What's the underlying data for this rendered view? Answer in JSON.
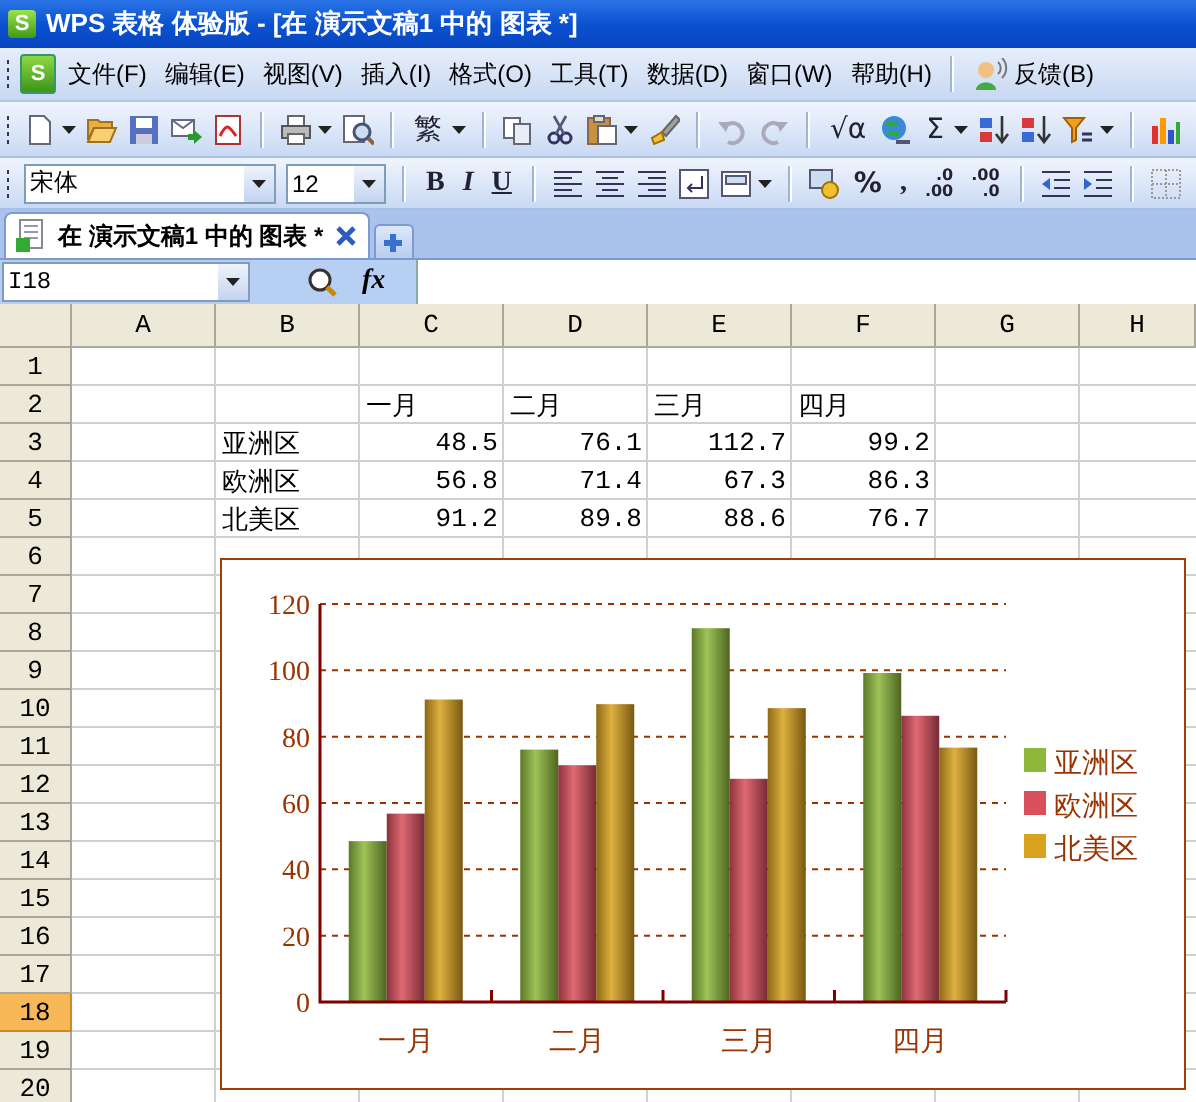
{
  "window": {
    "logo": "S",
    "title": "WPS 表格 体验版 - [在 演示文稿1 中的 图表 *]"
  },
  "menu": {
    "logo": "S",
    "items": [
      "文件(F)",
      "编辑(E)",
      "视图(V)",
      "插入(I)",
      "格式(O)",
      "工具(T)",
      "数据(D)",
      "窗口(W)",
      "帮助(H)"
    ],
    "feedback": "反馈(B)"
  },
  "toolbar1": [
    {
      "kind": "grip"
    },
    {
      "kind": "icon"
    },
    {
      "kind": "caret"
    },
    {
      "kind": "icon"
    },
    {
      "kind": "icon"
    },
    {
      "kind": "icon"
    },
    {
      "kind": "icon"
    },
    {
      "kind": "sep"
    },
    {
      "kind": "icon"
    },
    {
      "kind": "caret"
    },
    {
      "kind": "icon"
    },
    {
      "kind": "sep"
    },
    {
      "kind": "text",
      "text": "繁"
    },
    {
      "kind": "caret"
    },
    {
      "kind": "sep"
    },
    {
      "kind": "icon"
    },
    {
      "kind": "icon"
    },
    {
      "kind": "icon"
    },
    {
      "kind": "caret"
    },
    {
      "kind": "icon"
    },
    {
      "kind": "sep"
    },
    {
      "kind": "icon"
    },
    {
      "kind": "icon"
    },
    {
      "kind": "sep"
    },
    {
      "kind": "text",
      "text": "√α"
    },
    {
      "kind": "icon"
    },
    {
      "kind": "text",
      "text": "Σ"
    },
    {
      "kind": "caret"
    },
    {
      "kind": "icon"
    },
    {
      "kind": "icon"
    },
    {
      "kind": "icon"
    },
    {
      "kind": "caret"
    },
    {
      "kind": "sep"
    },
    {
      "kind": "icon"
    }
  ],
  "toolbar2": [
    {
      "kind": "grip"
    },
    {
      "kind": "select",
      "value": "宋体"
    },
    {
      "kind": "select",
      "value": "12"
    },
    {
      "kind": "sep"
    },
    {
      "kind": "text",
      "text": "B"
    },
    {
      "kind": "text",
      "text": "I"
    },
    {
      "kind": "text",
      "text": "U"
    },
    {
      "kind": "sep"
    },
    {
      "kind": "icon"
    },
    {
      "kind": "icon"
    },
    {
      "kind": "icon"
    },
    {
      "kind": "icon"
    },
    {
      "kind": "icon"
    },
    {
      "kind": "caret"
    },
    {
      "kind": "sep"
    },
    {
      "kind": "icon"
    },
    {
      "kind": "text",
      "text": "%"
    },
    {
      "kind": "text",
      "text": ","
    },
    {
      "kind": "stack",
      "lines": [
        ".0",
        ".00"
      ]
    },
    {
      "kind": "stack",
      "lines": [
        ".00",
        ".0"
      ]
    },
    {
      "kind": "sep"
    },
    {
      "kind": "icon"
    },
    {
      "kind": "icon"
    },
    {
      "kind": "sep"
    },
    {
      "kind": "icon"
    }
  ],
  "tabs": [
    {
      "label": "在 演示文稿1 中的 图表 *",
      "selected": true
    }
  ],
  "formula_bar": {
    "cell": "I18",
    "fx": "fx"
  },
  "columns": [
    "A",
    "B",
    "C",
    "D",
    "E",
    "F",
    "G",
    "H"
  ],
  "rows": [
    {
      "label": "1",
      "selected": false
    },
    {
      "label": "2",
      "selected": false
    },
    {
      "label": "3",
      "selected": false
    },
    {
      "label": "4",
      "selected": false
    },
    {
      "label": "5",
      "selected": false
    },
    {
      "label": "6",
      "selected": false
    },
    {
      "label": "7",
      "selected": false
    },
    {
      "label": "8",
      "selected": false
    },
    {
      "label": "9",
      "selected": false
    },
    {
      "label": "10",
      "selected": false
    },
    {
      "label": "11",
      "selected": false
    },
    {
      "label": "12",
      "selected": false
    },
    {
      "label": "13",
      "selected": false
    },
    {
      "label": "14",
      "selected": false
    },
    {
      "label": "15",
      "selected": false
    },
    {
      "label": "16",
      "selected": false
    },
    {
      "label": "17",
      "selected": false
    },
    {
      "label": "18",
      "selected": true
    },
    {
      "label": "19",
      "selected": false
    },
    {
      "label": "20",
      "selected": false
    }
  ],
  "data_block": {
    "months": [
      "一月",
      "二月",
      "三月",
      "四月"
    ],
    "regions": [
      {
        "name": "亚洲区",
        "values": [
          "48.5",
          "76.1",
          "112.7",
          "99.2"
        ]
      },
      {
        "name": "欧洲区",
        "values": [
          "56.8",
          "71.4",
          "67.3",
          "86.3"
        ]
      },
      {
        "name": "北美区",
        "values": [
          "91.2",
          "89.8",
          "88.6",
          "76.7"
        ]
      }
    ]
  },
  "chart_data": {
    "type": "bar",
    "categories": [
      "一月",
      "二月",
      "三月",
      "四月"
    ],
    "series": [
      {
        "name": "亚洲区",
        "color": "#8db83a",
        "values": [
          48.5,
          76.1,
          112.7,
          99.2
        ]
      },
      {
        "name": "欧洲区",
        "color": "#d94f5c",
        "values": [
          56.8,
          71.4,
          67.3,
          86.3
        ]
      },
      {
        "name": "北美区",
        "color": "#d9a21e",
        "values": [
          91.2,
          89.8,
          88.6,
          76.7
        ]
      }
    ],
    "ylim": [
      0,
      120
    ],
    "yticks": [
      0,
      20,
      40,
      60,
      80,
      100,
      120
    ],
    "grid": true,
    "legend": true
  }
}
